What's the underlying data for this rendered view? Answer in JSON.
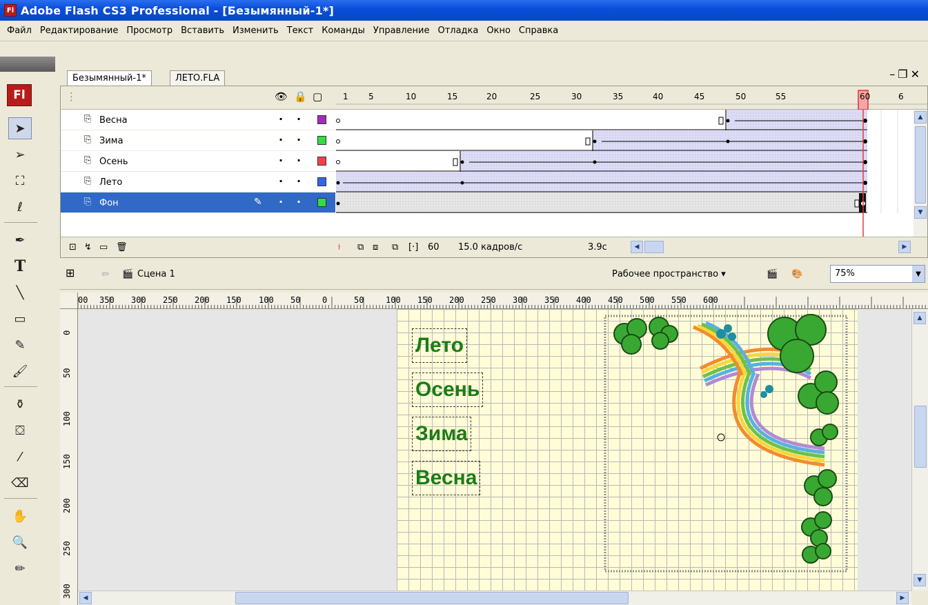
{
  "window": {
    "title": "Adobe Flash CS3 Professional - [Безымянный-1*]",
    "logo": "Fl"
  },
  "menu": [
    "Файл",
    "Редактирование",
    "Просмотр",
    "Вставить",
    "Изменить",
    "Текст",
    "Команды",
    "Управление",
    "Отладка",
    "Окно",
    "Справка"
  ],
  "tools": {
    "logo": "Fl"
  },
  "tabs": [
    {
      "label": "Безымянный-1*"
    },
    {
      "label": "ЛЕТО.FLA"
    }
  ],
  "timeline": {
    "frame_numbers": [
      "1",
      "5",
      "10",
      "15",
      "20",
      "25",
      "30",
      "35",
      "40",
      "45",
      "50",
      "55",
      "60",
      "6"
    ],
    "playhead_frame": "60",
    "layers": [
      {
        "name": "Весна",
        "color": "#a32bbf"
      },
      {
        "name": "Зима",
        "color": "#33dd44"
      },
      {
        "name": "Осень",
        "color": "#ee4444"
      },
      {
        "name": "Лето",
        "color": "#3366ee"
      },
      {
        "name": "Фон",
        "color": "#33dd44"
      }
    ],
    "footer": {
      "frame": "60",
      "fps": "15.0 кадров/с",
      "time": "3.9с"
    }
  },
  "scene": {
    "name": "Сцена 1",
    "workspace": "Рабочее пространство ▾",
    "zoom": "75%"
  },
  "ruler": {
    "h_labels": [
      "00",
      "350",
      "300",
      "250",
      "200",
      "150",
      "100",
      "50",
      "0",
      "50",
      "100",
      "150",
      "200",
      "250",
      "300",
      "350",
      "400",
      "450",
      "500",
      "550",
      "600"
    ],
    "v_labels": [
      "0",
      "50",
      "100",
      "150",
      "200",
      "250",
      "300"
    ]
  },
  "stage": {
    "words": [
      "Лето",
      "Осень",
      "Зима",
      "Весна"
    ]
  }
}
